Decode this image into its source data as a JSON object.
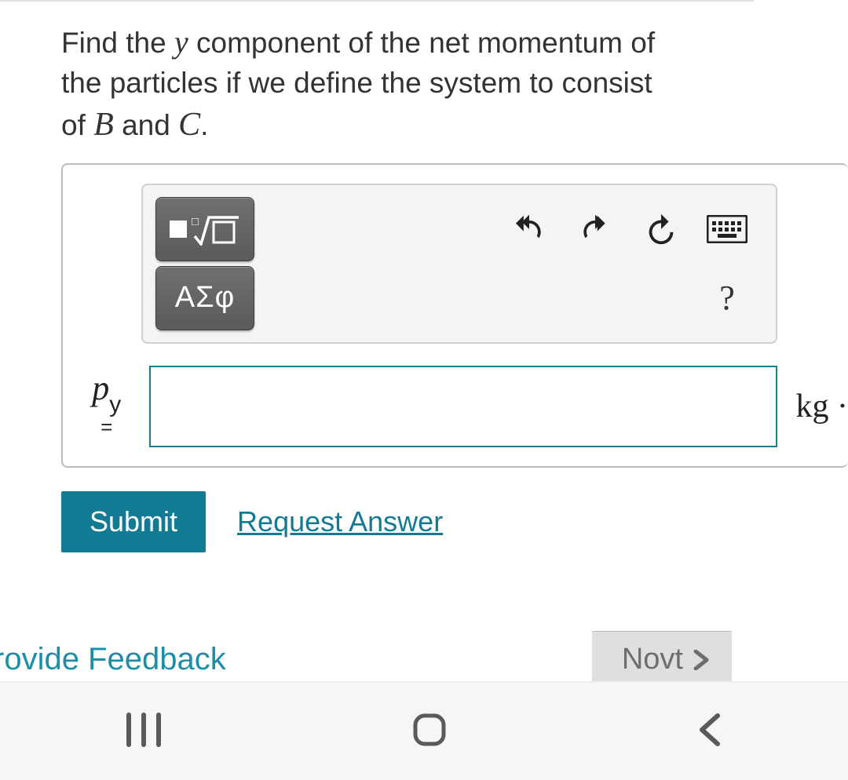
{
  "question": {
    "pre": "Find the ",
    "var1": "y",
    "mid": " component of the net momentum of the particles if we define the system to consist of ",
    "var2": "B",
    "and": " and ",
    "var3": "C",
    "post": "."
  },
  "toolbar": {
    "math_template_icon": "math-root-template",
    "greek_label": "ΑΣφ",
    "undo_icon": "undo-icon",
    "redo_icon": "redo-icon",
    "reset_icon": "reset-icon",
    "keyboard_icon": "keyboard-icon",
    "help_label": "?"
  },
  "input": {
    "var_letter": "p",
    "var_sub": "y",
    "equals": "=",
    "value": "",
    "unit": "kg ·"
  },
  "actions": {
    "submit": "Submit",
    "request": "Request Answer"
  },
  "footer": {
    "feedback": "rovide Feedback",
    "next": "Novt"
  }
}
